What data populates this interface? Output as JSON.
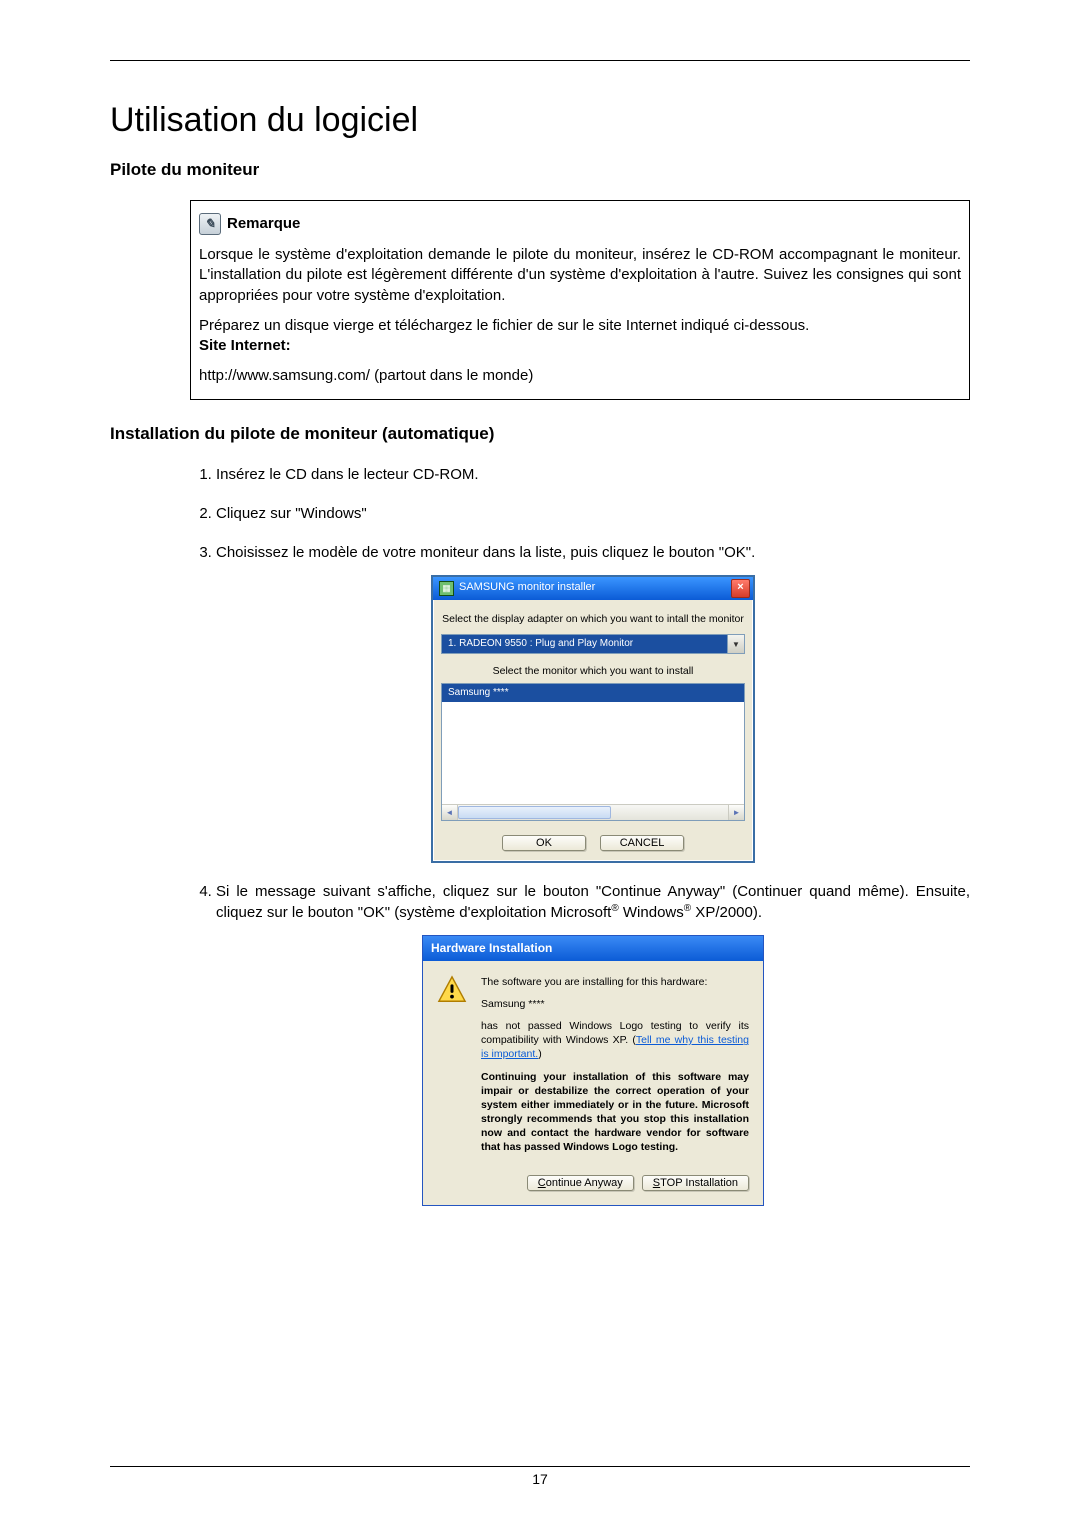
{
  "page_number": "17",
  "title": "Utilisation du logiciel",
  "section1_heading": "Pilote du moniteur",
  "note": {
    "label": "Remarque",
    "p1": "Lorsque le système d'exploitation demande le pilote du moniteur, insérez le CD-ROM accompagnant le moniteur. L'installation du pilote est légèrement différente d'un système d'exploitation à l'autre. Suivez les consignes qui sont appropriées pour votre système d'exploitation.",
    "p2": "Préparez un disque vierge et téléchargez le fichier de sur le site Internet indiqué ci-dessous.",
    "site_label": "Site Internet:",
    "url": "http://www.samsung.com/ (partout dans le monde)"
  },
  "section2_heading": "Installation du pilote de moniteur (automatique)",
  "steps": {
    "s1": "Insérez le CD dans le lecteur CD-ROM.",
    "s2": "Cliquez sur \"Windows\"",
    "s3": "Choisissez le modèle de votre moniteur dans la liste, puis cliquez le bouton \"OK\".",
    "s4a": "Si le message suivant s'affiche, cliquez sur le bouton \"Continue Anyway\" (Continuer quand même). Ensuite, cliquez sur le bouton \"OK\" (système d'exploitation Microsoft",
    "s4b": " Windows",
    "s4c": " XP/2000)."
  },
  "installer": {
    "title": "SAMSUNG monitor installer",
    "label1": "Select the display adapter on which you want to intall the monitor",
    "adapter": "1. RADEON 9550 : Plug and Play Monitor",
    "label2": "Select the monitor which you want to install",
    "monitor": "Samsung ****",
    "ok": "OK",
    "cancel": "CANCEL"
  },
  "hw": {
    "title": "Hardware Installation",
    "p1": "The software you are installing for this hardware:",
    "device": "Samsung ****",
    "p2a": "has not passed Windows Logo testing to verify its compatibility with Windows XP. (",
    "link": "Tell me why this testing is important.",
    "p2b": ")",
    "p3": "Continuing your installation of this software may impair or destabilize the correct operation of your system either immediately or in the future. Microsoft strongly recommends that you stop this installation now and contact the hardware vendor for software that has passed Windows Logo testing.",
    "btn_continue_pre": "C",
    "btn_continue_rest": "ontinue Anyway",
    "btn_stop_pre": "S",
    "btn_stop_rest": "TOP Installation"
  }
}
